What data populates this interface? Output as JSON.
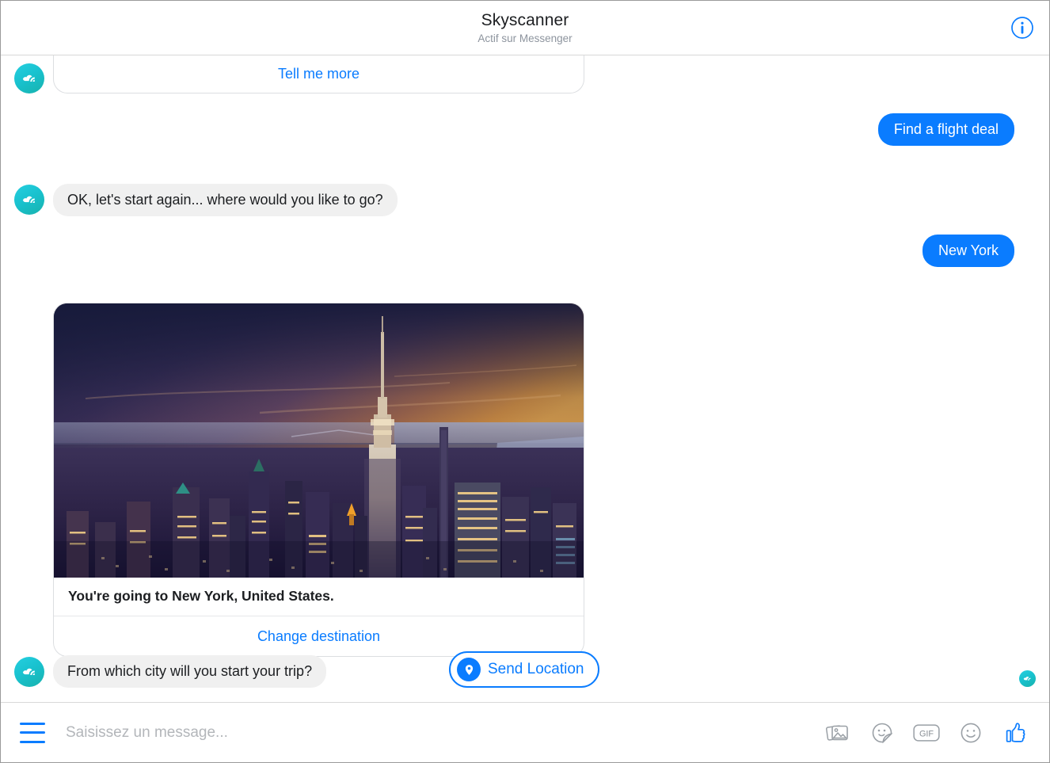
{
  "header": {
    "title": "Skyscanner",
    "subtitle": "Actif sur Messenger",
    "info_icon": "info-icon"
  },
  "thread": {
    "bot_avatar_icon": "skyscanner-logo-icon",
    "messages": [
      {
        "id": "card-top",
        "type": "card-button",
        "sender": "bot",
        "label": "Tell me more"
      },
      {
        "id": "msg-find-flight",
        "type": "text",
        "sender": "user",
        "text": "Find a flight deal"
      },
      {
        "id": "msg-start-again",
        "type": "text",
        "sender": "bot",
        "text": "OK, let's start again... where would you like to go?"
      },
      {
        "id": "msg-new-york",
        "type": "text",
        "sender": "user",
        "text": "New York"
      },
      {
        "id": "card-destination",
        "type": "card",
        "sender": "bot",
        "image_alt": "New York City skyline at sunset with the Empire State Building",
        "title": "You're going to New York, United States.",
        "action_label": "Change destination"
      },
      {
        "id": "msg-from-city",
        "type": "text",
        "sender": "bot",
        "text": "From which city will you start your trip?"
      }
    ],
    "quick_reply": {
      "label": "Send Location",
      "icon": "location-pin-icon"
    },
    "seen_receipt_icon": "skyscanner-logo-icon"
  },
  "composer": {
    "menu_icon": "hamburger-menu-icon",
    "placeholder": "Saisissez un message...",
    "input_value": "",
    "tools": [
      {
        "name": "photo-icon",
        "label": ""
      },
      {
        "name": "sticker-icon",
        "label": ""
      },
      {
        "name": "gif-icon",
        "label": "GIF"
      },
      {
        "name": "emoji-icon",
        "label": ""
      },
      {
        "name": "thumbs-up-icon",
        "label": ""
      }
    ]
  },
  "colors": {
    "accent_blue": "#0a7cff",
    "bot_bubble": "#f0f0f0",
    "text_primary": "#1c1e21",
    "text_secondary": "#8d949e",
    "brand_teal": "#19c2cf"
  }
}
